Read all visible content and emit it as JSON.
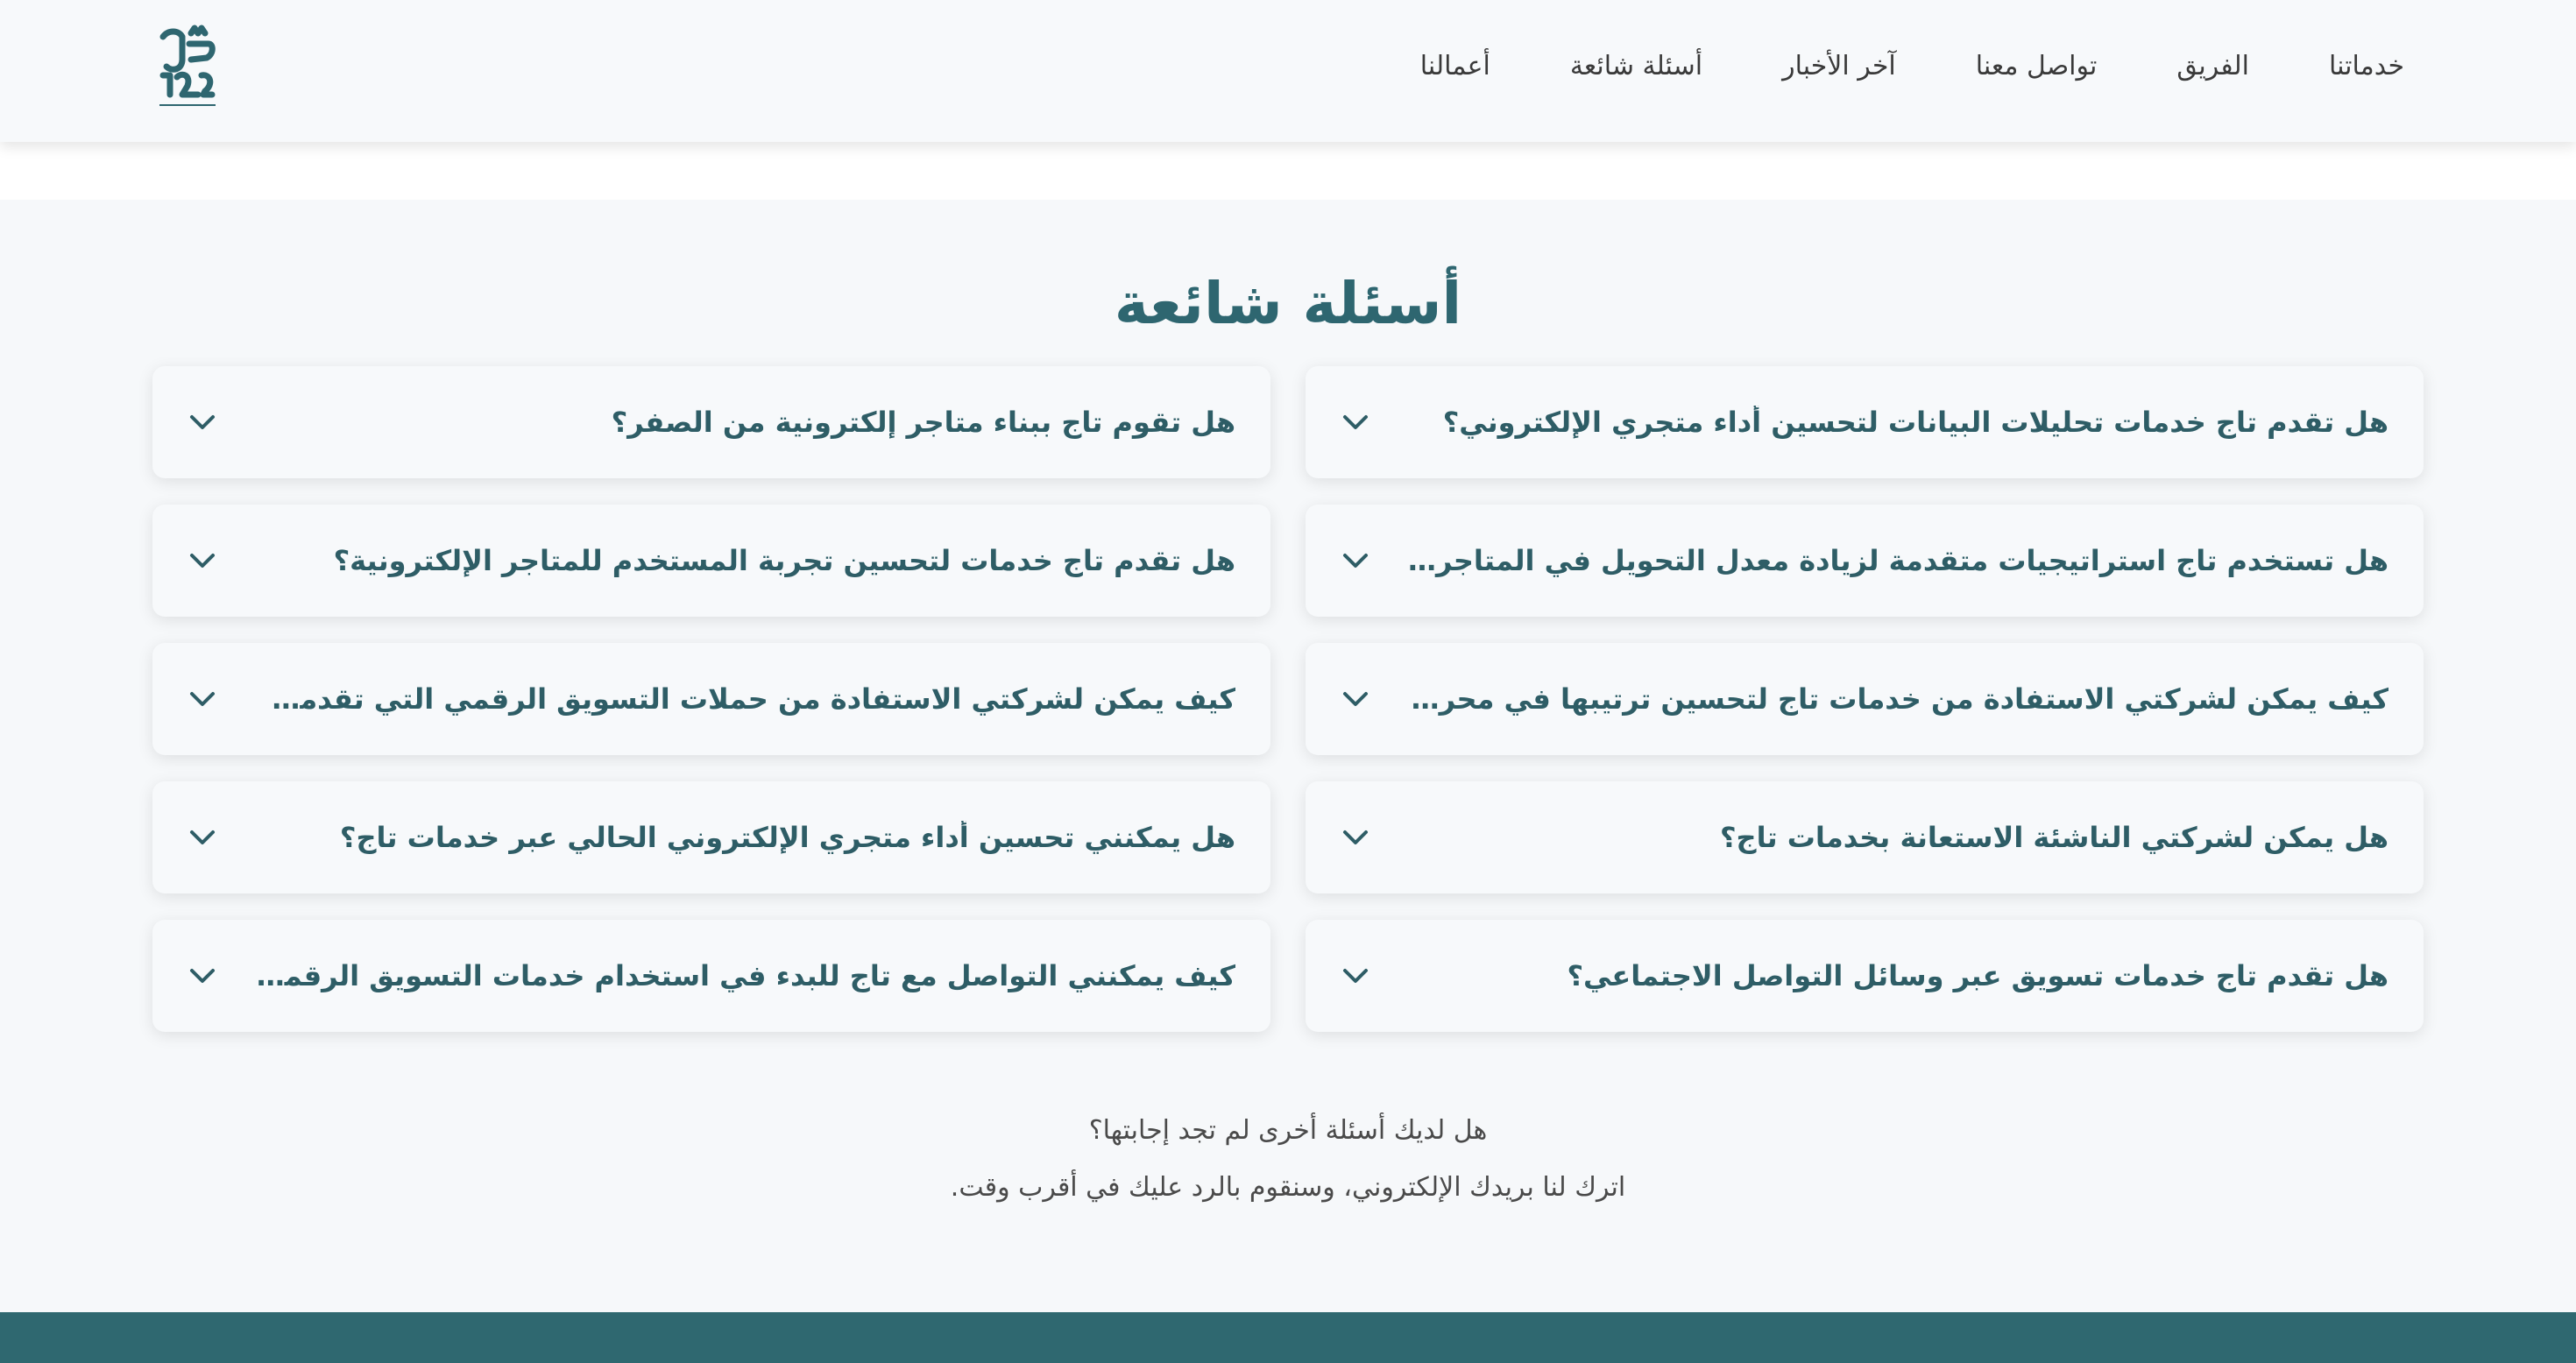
{
  "nav": {
    "items": [
      {
        "label": "خدماتنا"
      },
      {
        "label": "الفريق"
      },
      {
        "label": "تواصل معنا"
      },
      {
        "label": "آخر الأخبار"
      },
      {
        "label": "أسئلة شائعة"
      },
      {
        "label": "أعمالنا"
      }
    ]
  },
  "logo": {
    "icon": "taj-logo-icon",
    "color": "#2e6670"
  },
  "faq": {
    "title": "أسئلة شائعة",
    "questions": [
      {
        "text": "هل تقدم تاج خدمات تحليلات البيانات لتحسين أداء متجري الإلكتروني؟"
      },
      {
        "text": "هل تقوم تاج ببناء متاجر إلكترونية من الصفر؟"
      },
      {
        "text": "هل تستخدم تاج استراتيجيات متقدمة لزيادة معدل التحويل في المتاجر الإلكترونية؟"
      },
      {
        "text": "هل تقدم تاج خدمات لتحسين تجربة المستخدم للمتاجر الإلكترونية؟"
      },
      {
        "text": "كيف يمكن لشركتي الاستفادة من خدمات تاج لتحسين ترتيبها في محركات البحث؟"
      },
      {
        "text": "كيف يمكن لشركتي الاستفادة من حملات التسويق الرقمي التي تقدمها تاج؟"
      },
      {
        "text": "هل يمكن لشركتي الناشئة الاستعانة بخدمات تاج؟"
      },
      {
        "text": "هل يمكنني تحسين أداء متجري الإلكتروني الحالي عبر خدمات تاج؟"
      },
      {
        "text": "هل تقدم تاج خدمات تسويق عبر وسائل التواصل الاجتماعي؟"
      },
      {
        "text": "كيف يمكنني التواصل مع تاج للبدء في استخدام خدمات التسويق الرقمي؟"
      }
    ],
    "more_line1": "هل لديك أسئلة أخرى لم تجد إجابتها؟",
    "more_line2": "اترك لنا بريدك الإلكتروني، وسنقوم بالرد عليك في أقرب وقت."
  },
  "colors": {
    "brand": "#2e6670",
    "question_text": "#2e5d66",
    "footer": "#2f6870"
  }
}
